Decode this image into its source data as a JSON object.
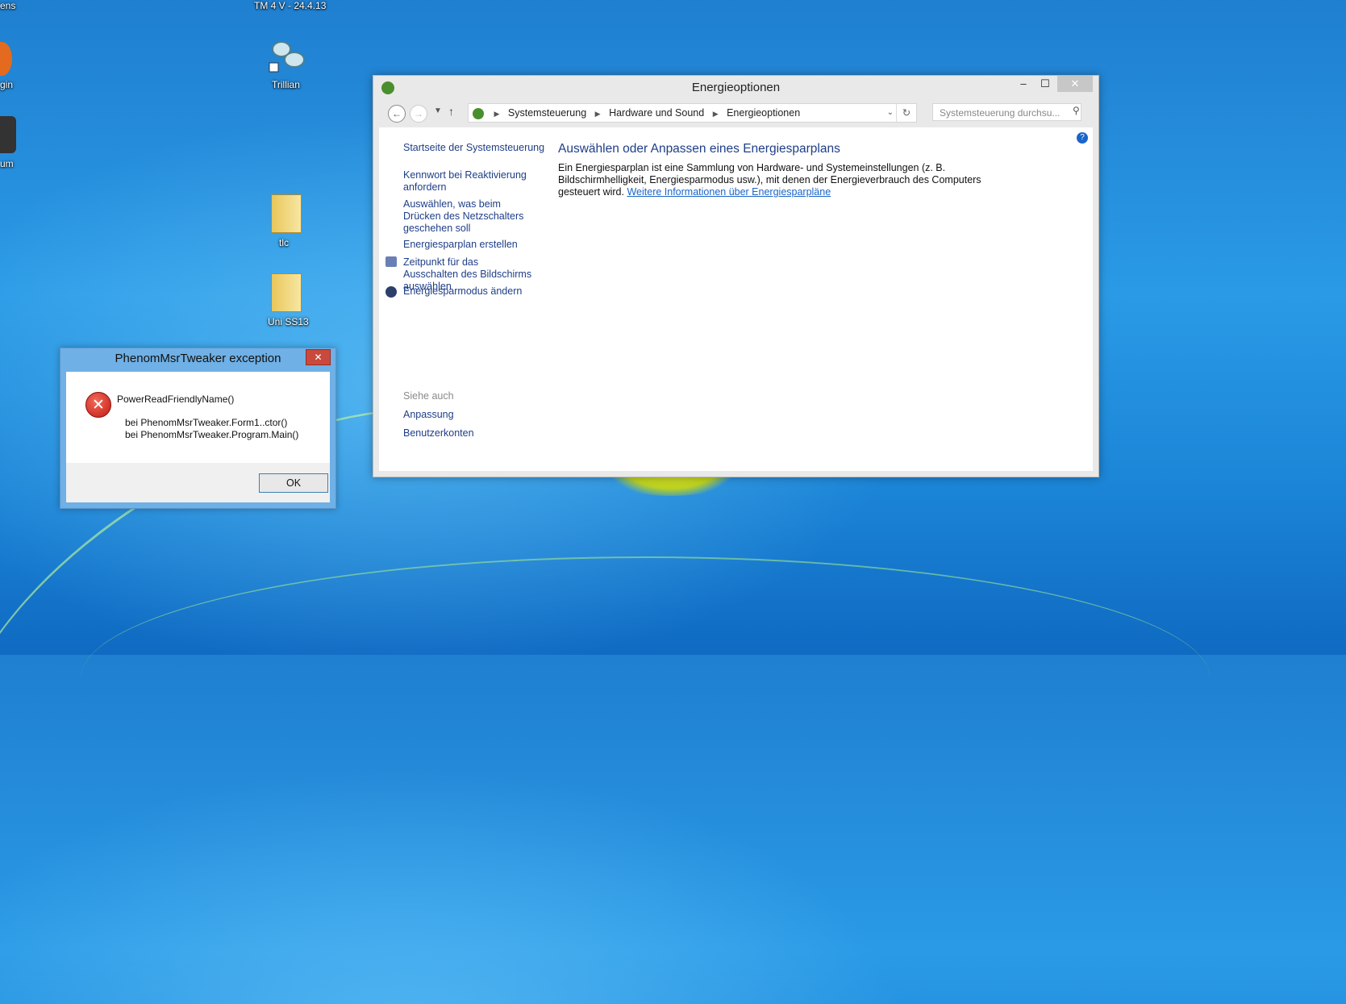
{
  "desktop": {
    "icons": [
      {
        "label": "ens"
      },
      {
        "label": "TM 4 V - 24.4.13"
      },
      {
        "label": "gin"
      },
      {
        "label": "Trillian"
      },
      {
        "label": "um"
      },
      {
        "label": "tlc"
      },
      {
        "label": "Uni SS13"
      }
    ]
  },
  "control_panel": {
    "title": "Energieoptionen",
    "controls": {
      "minimize": "–",
      "maximize": "☐",
      "close": "✕"
    },
    "breadcrumb": [
      "Systemsteuerung",
      "Hardware und Sound",
      "Energieoptionen"
    ],
    "search_placeholder": "Systemsteuerung durchsu...",
    "sidebar": {
      "links": [
        "Startseite der Systemsteuerung",
        "Kennwort bei Reaktivierung anfordern",
        "Auswählen, was beim Drücken des Netzschalters geschehen soll",
        "Energiesparplan erstellen",
        "Zeitpunkt für das Ausschalten des Bildschirms auswählen",
        "Energiesparmodus ändern"
      ],
      "see_also_heading": "Siehe auch",
      "see_also": [
        "Anpassung",
        "Benutzerkonten"
      ]
    },
    "main": {
      "heading": "Auswählen oder Anpassen eines Energiesparplans",
      "description": "Ein Energiesparplan ist eine Sammlung von Hardware- und Systemeinstellungen (z. B. Bildschirmhelligkeit, Energiesparmodus usw.), mit denen der Energieverbrauch des Computers gesteuert wird.",
      "more_link": "Weitere Informationen über Energiesparpläne"
    }
  },
  "exception_dialog": {
    "title": "PhenomMsrTweaker exception",
    "close": "✕",
    "message": "PowerReadFriendlyName()",
    "stack": [
      "bei PhenomMsrTweaker.Form1..ctor()",
      "bei PhenomMsrTweaker.Program.Main()"
    ],
    "ok_label": "OK"
  }
}
